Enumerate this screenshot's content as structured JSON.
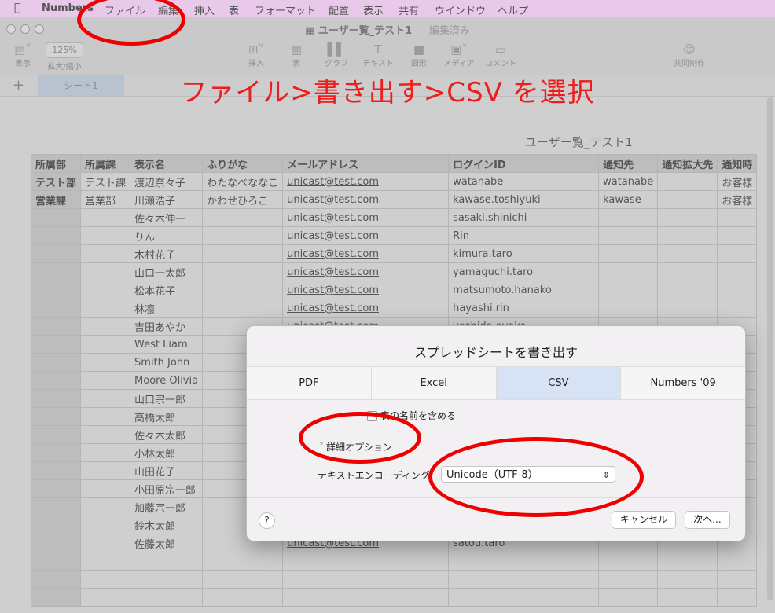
{
  "menubar": {
    "app_name": "Numbers",
    "items": [
      "ファイル",
      "編集",
      "挿入",
      "表",
      "フォーマット",
      "配置",
      "表示",
      "共有",
      "ウインドウ",
      "ヘルプ"
    ]
  },
  "window": {
    "title": "ユーザー覧_テスト1",
    "title_suffix": "— 編集済み",
    "toolbar": {
      "view_label": "表示",
      "zoom_value": "125%",
      "zoom_label": "拡大/縮小",
      "insert_label": "挿入",
      "table_label": "表",
      "chart_label": "グラフ",
      "text_label": "テキスト",
      "shape_label": "図形",
      "media_label": "メディア",
      "comment_label": "コメント",
      "collab_label": "共同制作"
    },
    "sheet_tab": "シート1"
  },
  "annotation": "ファイル>書き出す>CSV を選択",
  "table": {
    "title": "ユーザー覧_テスト1",
    "headers": [
      "所属部",
      "所属課",
      "表示名",
      "ふりがな",
      "メールアドレス",
      "ログインID",
      "通知先",
      "通知拡大先",
      "通知時"
    ],
    "rows": [
      [
        "テスト部",
        "テスト課",
        "渡辺奈々子",
        "わたなべななこ",
        "unicast@test.com",
        "watanabe",
        "watanabe",
        "",
        "お客様"
      ],
      [
        "営業課",
        "営業部",
        "川瀬浩子",
        "かわせひろこ",
        "unicast@test.com",
        "kawase.toshiyuki",
        "kawase",
        "",
        "お客様"
      ],
      [
        "",
        "",
        "佐々木伸一",
        "",
        "unicast@test.com",
        "sasaki.shinichi",
        "",
        "",
        ""
      ],
      [
        "",
        "",
        "りん",
        "",
        "unicast@test.com",
        "Rin",
        "",
        "",
        ""
      ],
      [
        "",
        "",
        "木村花子",
        "",
        "unicast@test.com",
        "kimura.taro",
        "",
        "",
        ""
      ],
      [
        "",
        "",
        "山口一太郎",
        "",
        "unicast@test.com",
        "yamaguchi.taro",
        "",
        "",
        ""
      ],
      [
        "",
        "",
        "松本花子",
        "",
        "unicast@test.com",
        "matsumoto.hanako",
        "",
        "",
        ""
      ],
      [
        "",
        "",
        "林凛",
        "",
        "unicast@test.com",
        "hayashi.rin",
        "",
        "",
        ""
      ],
      [
        "",
        "",
        "吉田あやか",
        "",
        "unicast@test.com",
        "yoshida.ayaka",
        "",
        "",
        ""
      ],
      [
        "",
        "",
        "West Liam",
        "",
        "",
        "",
        "",
        "",
        ""
      ],
      [
        "",
        "",
        "Smith John",
        "",
        "",
        "",
        "",
        "",
        ""
      ],
      [
        "",
        "",
        "Moore Olivia",
        "",
        "",
        "",
        "",
        "",
        ""
      ],
      [
        "",
        "",
        "山口宗一郎",
        "",
        "",
        "",
        "",
        "",
        ""
      ],
      [
        "",
        "",
        "高橋太郎",
        "",
        "",
        "",
        "",
        "",
        ""
      ],
      [
        "",
        "",
        "佐々木太郎",
        "",
        "",
        "",
        "",
        "",
        ""
      ],
      [
        "",
        "",
        "小林太郎",
        "",
        "",
        "",
        "",
        "",
        ""
      ],
      [
        "",
        "",
        "山田花子",
        "",
        "",
        "",
        "",
        "",
        ""
      ],
      [
        "",
        "",
        "小田原宗一郎",
        "",
        "",
        "",
        "",
        "",
        ""
      ],
      [
        "",
        "",
        "加藤宗一郎",
        "",
        "",
        "",
        "",
        "",
        ""
      ],
      [
        "",
        "",
        "鈴木太郎",
        "",
        "",
        "",
        "",
        "",
        ""
      ],
      [
        "",
        "",
        "佐藤太郎",
        "",
        "unicast@test.com",
        "satou.taro",
        "",
        "",
        ""
      ],
      [
        "",
        "",
        "",
        "",
        "",
        "",
        "",
        "",
        ""
      ],
      [
        "",
        "",
        "",
        "",
        "",
        "",
        "",
        "",
        ""
      ],
      [
        "",
        "",
        "",
        "",
        "",
        "",
        "",
        "",
        ""
      ]
    ]
  },
  "dialog": {
    "title": "スプレッドシートを書き出す",
    "tabs": [
      "PDF",
      "Excel",
      "CSV",
      "Numbers '09"
    ],
    "active_tab": "CSV",
    "include_table_names": "表の名前を含める",
    "advanced_options": "詳細オプション",
    "encoding_label": "テキストエンコーディング:",
    "encoding_value": "Unicode（UTF-8）",
    "help": "?",
    "cancel": "キャンセル",
    "next": "次へ..."
  },
  "colors": {
    "annotation_red": "#ee1c1c",
    "active_tab_bg": "#d7e3f4",
    "menubar_bg": "#e9c9e9"
  }
}
